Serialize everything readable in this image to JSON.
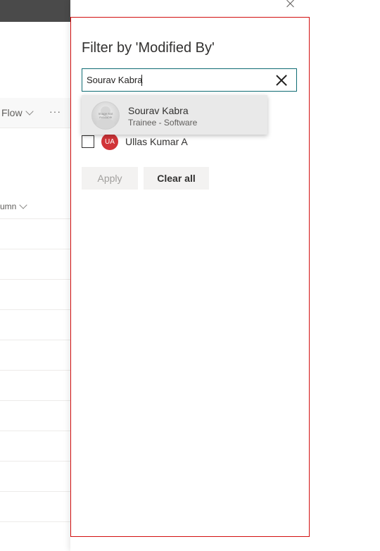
{
  "background": {
    "flow_label": "Flow",
    "more_label": "···",
    "column_label": "umn"
  },
  "panel": {
    "title": "Filter by 'Modified By'",
    "search": {
      "value": "Sourav Kabra",
      "placeholder": ""
    },
    "suggestion": {
      "name": "Sourav Kabra",
      "job_title": "Trainee - Software",
      "avatar_text": "Image Not Available"
    },
    "people": [
      {
        "initials": "UA",
        "name": "Ullas Kumar A",
        "checked": false,
        "avatar_color": "#d13438"
      }
    ],
    "buttons": {
      "apply": "Apply",
      "clear_all": "Clear all"
    }
  },
  "colors": {
    "highlight_frame": "#d20f0f",
    "search_border": "#0f6c74",
    "topbar": "#4a4a4a"
  }
}
